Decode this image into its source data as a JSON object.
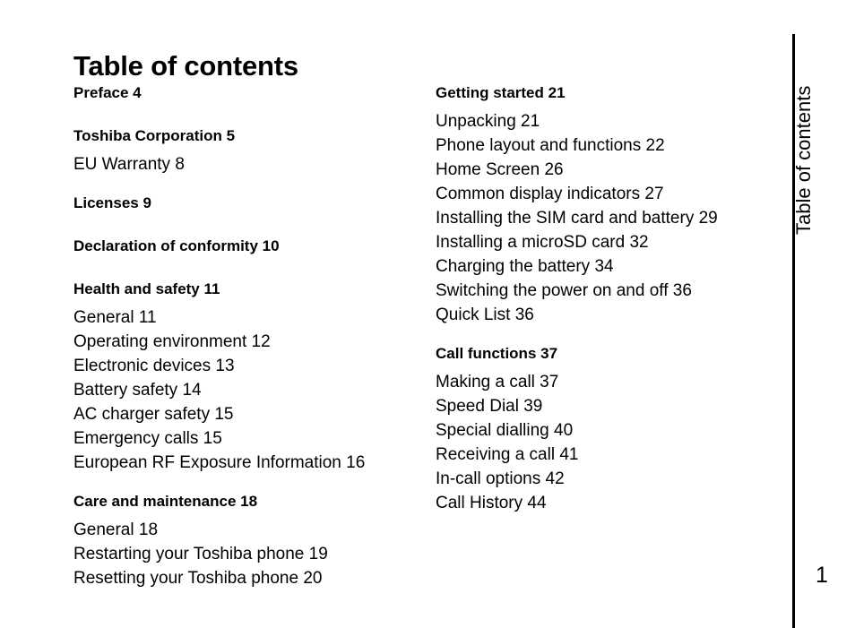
{
  "document": {
    "title": "Table of contents",
    "side_tab_label": "Table of contents",
    "page_number": "1",
    "rule_color": "#000000",
    "background_color": "#ffffff",
    "text_color": "#000000"
  },
  "columns": [
    {
      "id": "left",
      "groups": [
        {
          "heading": "Preface 4",
          "entries": []
        },
        {
          "heading": "Toshiba Corporation 5",
          "entries": [
            "EU Warranty 8"
          ]
        },
        {
          "heading": "Licenses 9",
          "entries": []
        },
        {
          "heading": "Declaration of conformity 10",
          "entries": []
        },
        {
          "heading": "Health and safety 11",
          "entries": [
            "General 11",
            "Operating environment 12",
            "Electronic devices 13",
            "Battery safety 14",
            "AC charger safety 15",
            "Emergency calls 15",
            "European RF Exposure Information 16"
          ]
        },
        {
          "heading": "Care and maintenance 18",
          "entries": [
            "General 18",
            "Restarting your Toshiba phone 19",
            "Resetting your Toshiba phone 20"
          ]
        }
      ]
    },
    {
      "id": "right",
      "groups": [
        {
          "heading": "Getting started 21",
          "entries": [
            "Unpacking 21",
            "Phone layout and functions 22",
            "Home Screen 26",
            "Common display indicators 27",
            "Installing the SIM card and battery 29",
            "Installing a microSD card 32",
            "Charging the battery 34",
            "Switching the power on and off 36",
            "Quick List 36"
          ]
        },
        {
          "heading": "Call functions 37",
          "entries": [
            "Making a call 37",
            "Speed Dial 39",
            "Special dialling 40",
            "Receiving a call 41",
            "In-call options 42",
            "Call History 44"
          ]
        }
      ]
    }
  ]
}
